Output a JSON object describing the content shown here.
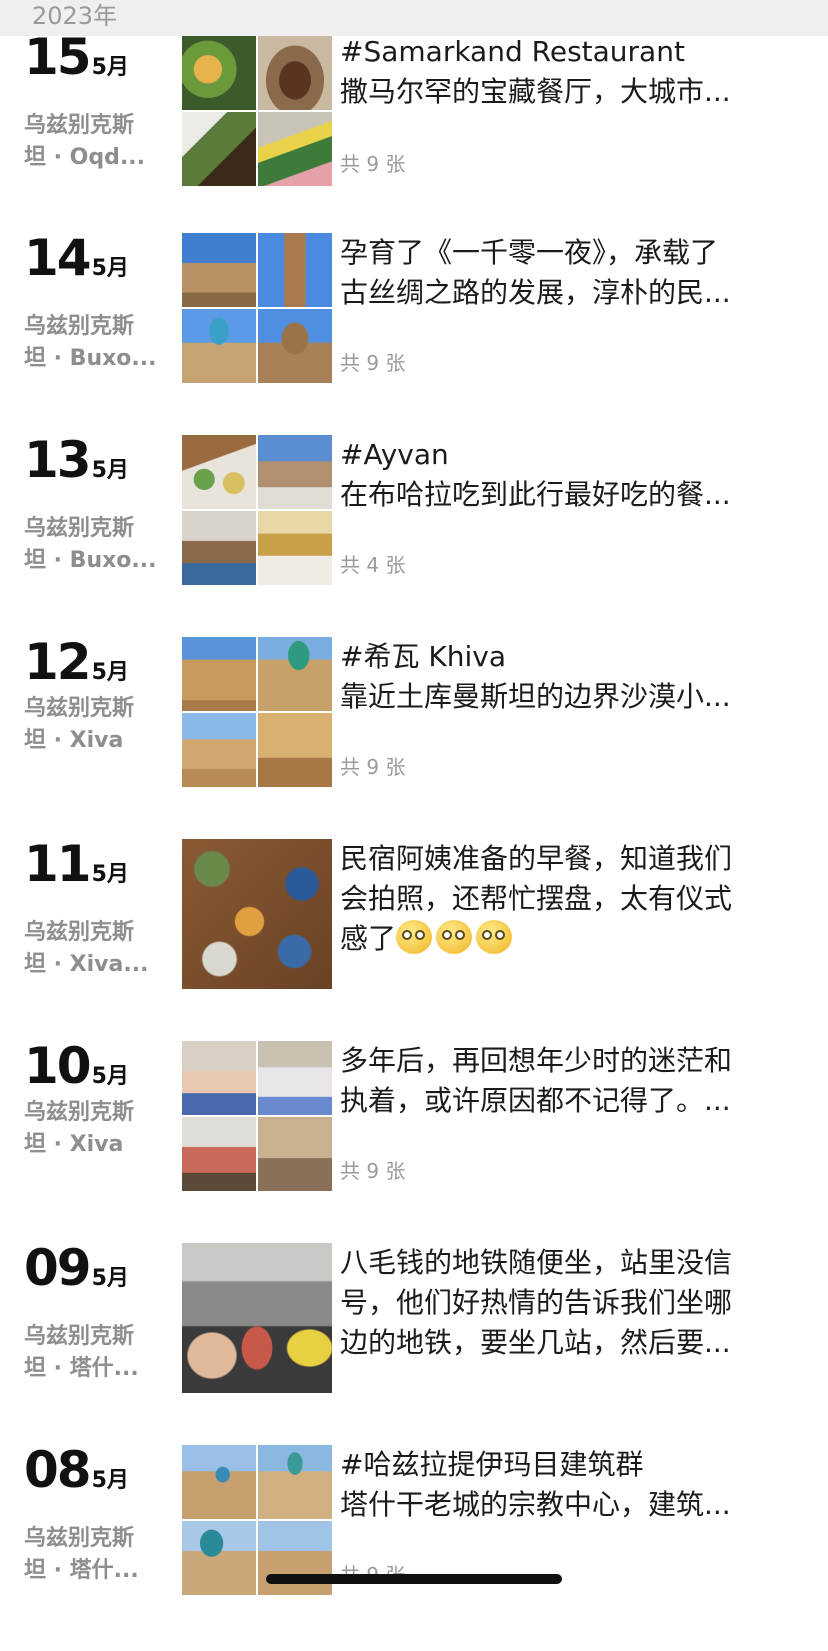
{
  "header": {
    "year": "2023年"
  },
  "entries": [
    {
      "day": "15",
      "month": "5月",
      "loc1": "乌兹别克斯",
      "loc2": "坦 · Oqd...",
      "line1": "#Samarkand Restaurant",
      "line2": "撒马尔罕的宝藏餐厅，大城市...",
      "line3": "",
      "count": "共 9 张",
      "photos": [
        "food-platter-photo",
        "plov-plate-photo",
        "sandwich-photo",
        "salad-drinks-photo"
      ]
    },
    {
      "day": "14",
      "month": "5月",
      "loc1": "乌兹别克斯",
      "loc2": "坦 · Buxo...",
      "line1": "孕育了《一千零一夜》，承载了",
      "line2": "古丝绸之路的发展，淳朴的民...",
      "line3": "",
      "count": "共 9 张",
      "photos": [
        "city-wall-photo",
        "minaret-photo",
        "blue-dome-photo",
        "mausoleum-photo"
      ]
    },
    {
      "day": "13",
      "month": "5月",
      "loc1": "乌兹别克斯",
      "loc2": "坦 · Buxo...",
      "line1": "#Ayvan",
      "line2": "在布哈拉吃到此行最好吃的餐...",
      "line3": "",
      "count": "共 4 张",
      "photos": [
        "dishes-table-photo",
        "courtyard-photo",
        "dining-room-photo",
        "ornate-hall-photo"
      ]
    },
    {
      "day": "12",
      "month": "5月",
      "loc1": "乌兹别克斯",
      "loc2": "坦 · Xiva",
      "line1": "#希瓦 Khiva",
      "line2": "靠近土库曼斯坦的边界沙漠小...",
      "line3": "",
      "count": "共 9 张",
      "photos": [
        "gate-towers-photo",
        "green-dome-photo",
        "desert-street-photo",
        "camel-wall-photo"
      ]
    },
    {
      "day": "11",
      "month": "5月",
      "loc1": "乌兹别克斯",
      "loc2": "坦 · Xiva...",
      "line1": "民宿阿姨准备的早餐，知道我们",
      "line2": "会拍照，还帮忙摆盘，太有仪式",
      "line3": "感了",
      "count": "",
      "photos": [
        "breakfast-table-photo"
      ]
    },
    {
      "day": "10",
      "month": "5月",
      "loc1": "乌兹别克斯",
      "loc2": "坦 · Xiva",
      "line1": "多年后，再回想年少时的迷茫和",
      "line2": "执着，或许原因都不记得了。...",
      "line3": "",
      "count": "共 9 张",
      "photos": [
        "girls-sitting-photo",
        "girls-standing-photo",
        "kids-group-photo",
        "doorway-kids-photo"
      ]
    },
    {
      "day": "09",
      "month": "5月",
      "loc1": "乌兹别克斯",
      "loc2": "坦 · 塔什...",
      "line1": "八毛钱的地铁随便坐，站里没信",
      "line2": "号，他们好热情的告诉我们坐哪",
      "line3": "边的地铁，要坐几站，然后要...",
      "count": "",
      "photos": [
        "metro-crowd-photo"
      ]
    },
    {
      "day": "08",
      "month": "5月",
      "loc1": "乌兹别克斯",
      "loc2": "坦 · 塔什...",
      "line1": "#哈兹拉提伊玛目建筑群",
      "line2": "塔什干老城的宗教中心，建筑...",
      "line3": "",
      "count": "共 9 张",
      "photos": [
        "mosque-front-photo",
        "mosque-facade-photo",
        "blue-domes-photo",
        "minarets-photo"
      ]
    }
  ]
}
